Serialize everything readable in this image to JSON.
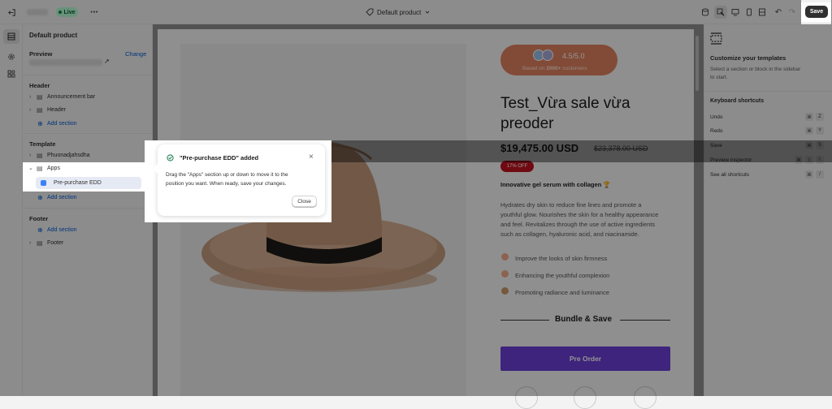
{
  "topbar": {
    "store_status": "Live",
    "template_name": "Default product",
    "save_label": "Save"
  },
  "sidebar": {
    "title": "Default product",
    "preview_label": "Preview",
    "change_label": "Change",
    "header_section_label": "Header",
    "announcement_bar": "Announcement bar",
    "header_item": "Header",
    "add_section": "Add section",
    "template_section_label": "Template",
    "phuonadjahsdha": "Phuonadjahsdha",
    "apps": "Apps",
    "pre_purchase": "Pre-purchase EDD",
    "footer_section_label": "Footer",
    "footer_item": "Footer"
  },
  "popup": {
    "title": "\"Pre-purchase EDD\" added",
    "body_line1": "Drag the \"Apps\" section up or down to move it to the",
    "body_line2": "position you want. When ready, save your changes.",
    "close_label": "Close",
    "success_color": "#29845a"
  },
  "product": {
    "rating": "4.5/5.0",
    "rating_sub_bold": "2000+",
    "rating_sub_prefix": "Based on",
    "rating_sub_suffix": "customers",
    "title_line1": "Test_Vừa sale vừa",
    "title_line2": "preoder",
    "price": "$19,475.00 USD",
    "compare_price": "$23,378.00 USD",
    "discount": "17% OFF",
    "subtitle": "Innovative gel serum with collagen 🏆",
    "desc_line1": "Hydrates dry skin to reduce fine lines and promote a",
    "desc_line2": "youthful glow. Nourishes the skin for a healthy appearance",
    "desc_line3": "and feel. Revitalizes through the use of active ingredients",
    "desc_line4": "such as collagen, hyaluronic acid, and niacinamide.",
    "benefits": [
      "Improve the looks of skin firmness",
      "Enhancing the youthful complexion",
      "Promoting radiance and luminance"
    ],
    "bundle_heading": "Bundle & Save",
    "cta": "Pre Order",
    "accent": "#6c3ed6",
    "rating_bg": "#e0825f"
  },
  "right": {
    "heading": "Customize your templates",
    "desc_line1": "Select a section or block in the sidebar",
    "desc_line2": "to start.",
    "shortcuts_title": "Keyboard shortcuts",
    "shortcuts": [
      {
        "label": "Undo",
        "k1": "⌘",
        "k2": "Z"
      },
      {
        "label": "Redo",
        "k1": "⌘",
        "k2": "Y"
      },
      {
        "label": "Save",
        "k1": "⌘",
        "k2": "S"
      },
      {
        "label": "Preview inspector",
        "k1": "⌘",
        "k2": "⇧",
        "k3": "I"
      },
      {
        "label": "See all shortcuts",
        "k1": "⌘",
        "k2": "/"
      }
    ]
  }
}
